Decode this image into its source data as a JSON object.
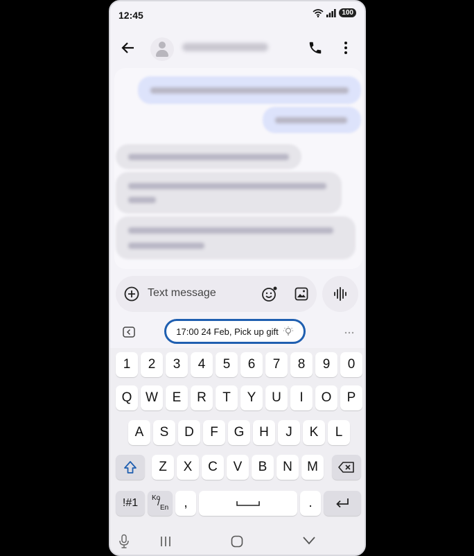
{
  "status_bar": {
    "time": "12:45",
    "battery": "100"
  },
  "compose": {
    "placeholder": "Text message"
  },
  "suggestion": {
    "label": "17:00 24 Feb, Pick up gift"
  },
  "keyboard": {
    "row_numbers": [
      "1",
      "2",
      "3",
      "4",
      "5",
      "6",
      "7",
      "8",
      "9",
      "0"
    ],
    "row_q": [
      "Q",
      "W",
      "E",
      "R",
      "T",
      "Y",
      "U",
      "I",
      "O",
      "P"
    ],
    "row_a": [
      "A",
      "S",
      "D",
      "F",
      "G",
      "H",
      "J",
      "K",
      "L"
    ],
    "row_z": [
      "Z",
      "X",
      "C",
      "V",
      "B",
      "N",
      "M"
    ],
    "symbols_label": "!#1",
    "lang_top": "Ko",
    "lang_bottom": "En",
    "comma": ",",
    "period": "."
  }
}
